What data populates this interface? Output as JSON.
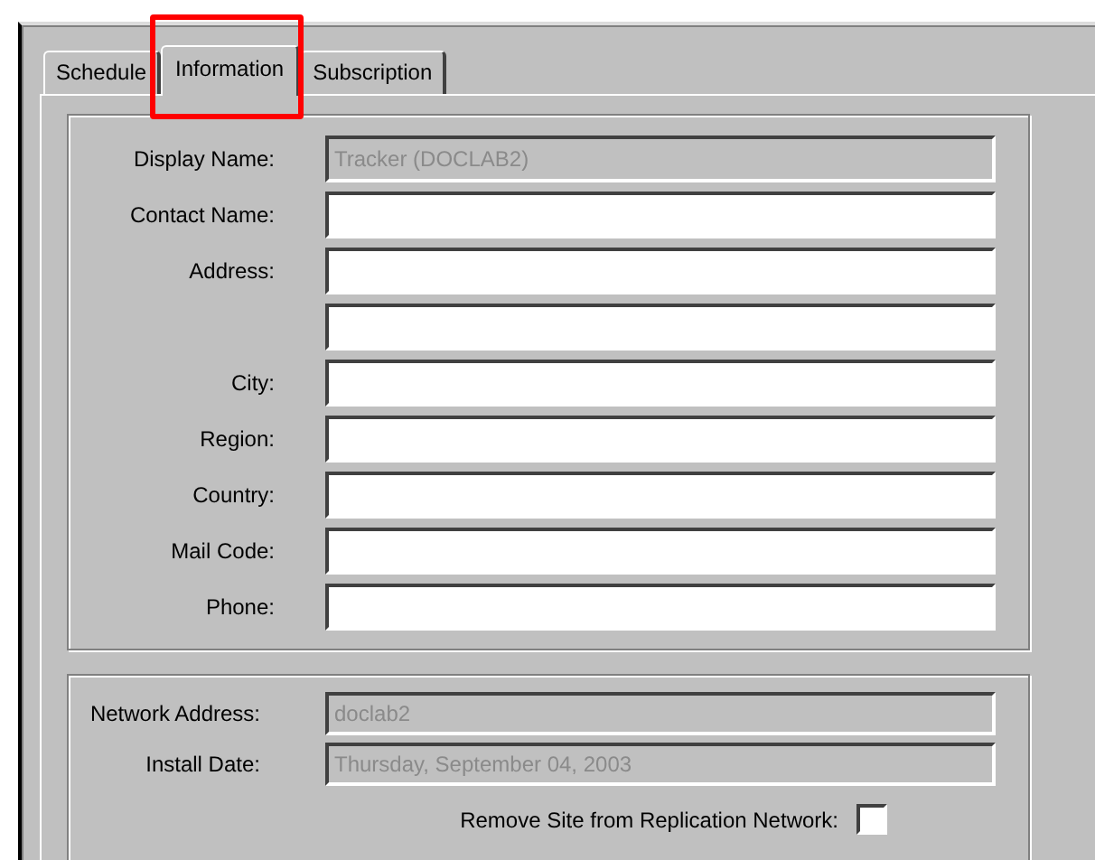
{
  "tabs": [
    {
      "label": "Schedule",
      "selected": false,
      "highlighted": false
    },
    {
      "label": "Information",
      "selected": true,
      "highlighted": true
    },
    {
      "label": "Subscription",
      "selected": false,
      "highlighted": false
    }
  ],
  "site_fields": [
    {
      "label": "Display Name:",
      "value": "Tracker (DOCLAB2)",
      "disabled": true
    },
    {
      "label": "Contact Name:",
      "disabled": false
    },
    {
      "label": "Address:",
      "disabled": false
    },
    {
      "disabled": false
    },
    {
      "label": "City:",
      "disabled": false
    },
    {
      "label": "Region:",
      "disabled": false
    },
    {
      "label": "Country:",
      "disabled": false
    },
    {
      "label": "Mail Code:",
      "disabled": false
    },
    {
      "label": "Phone:",
      "disabled": false
    }
  ],
  "network_fields": [
    {
      "label": "Network Address:",
      "value": "doclab2",
      "disabled": true
    },
    {
      "label": "Install Date:",
      "value": "Thursday, September 04, 2003",
      "disabled": true
    }
  ],
  "remove_site": {
    "label": "Remove Site from Replication Network:",
    "checked": false
  }
}
